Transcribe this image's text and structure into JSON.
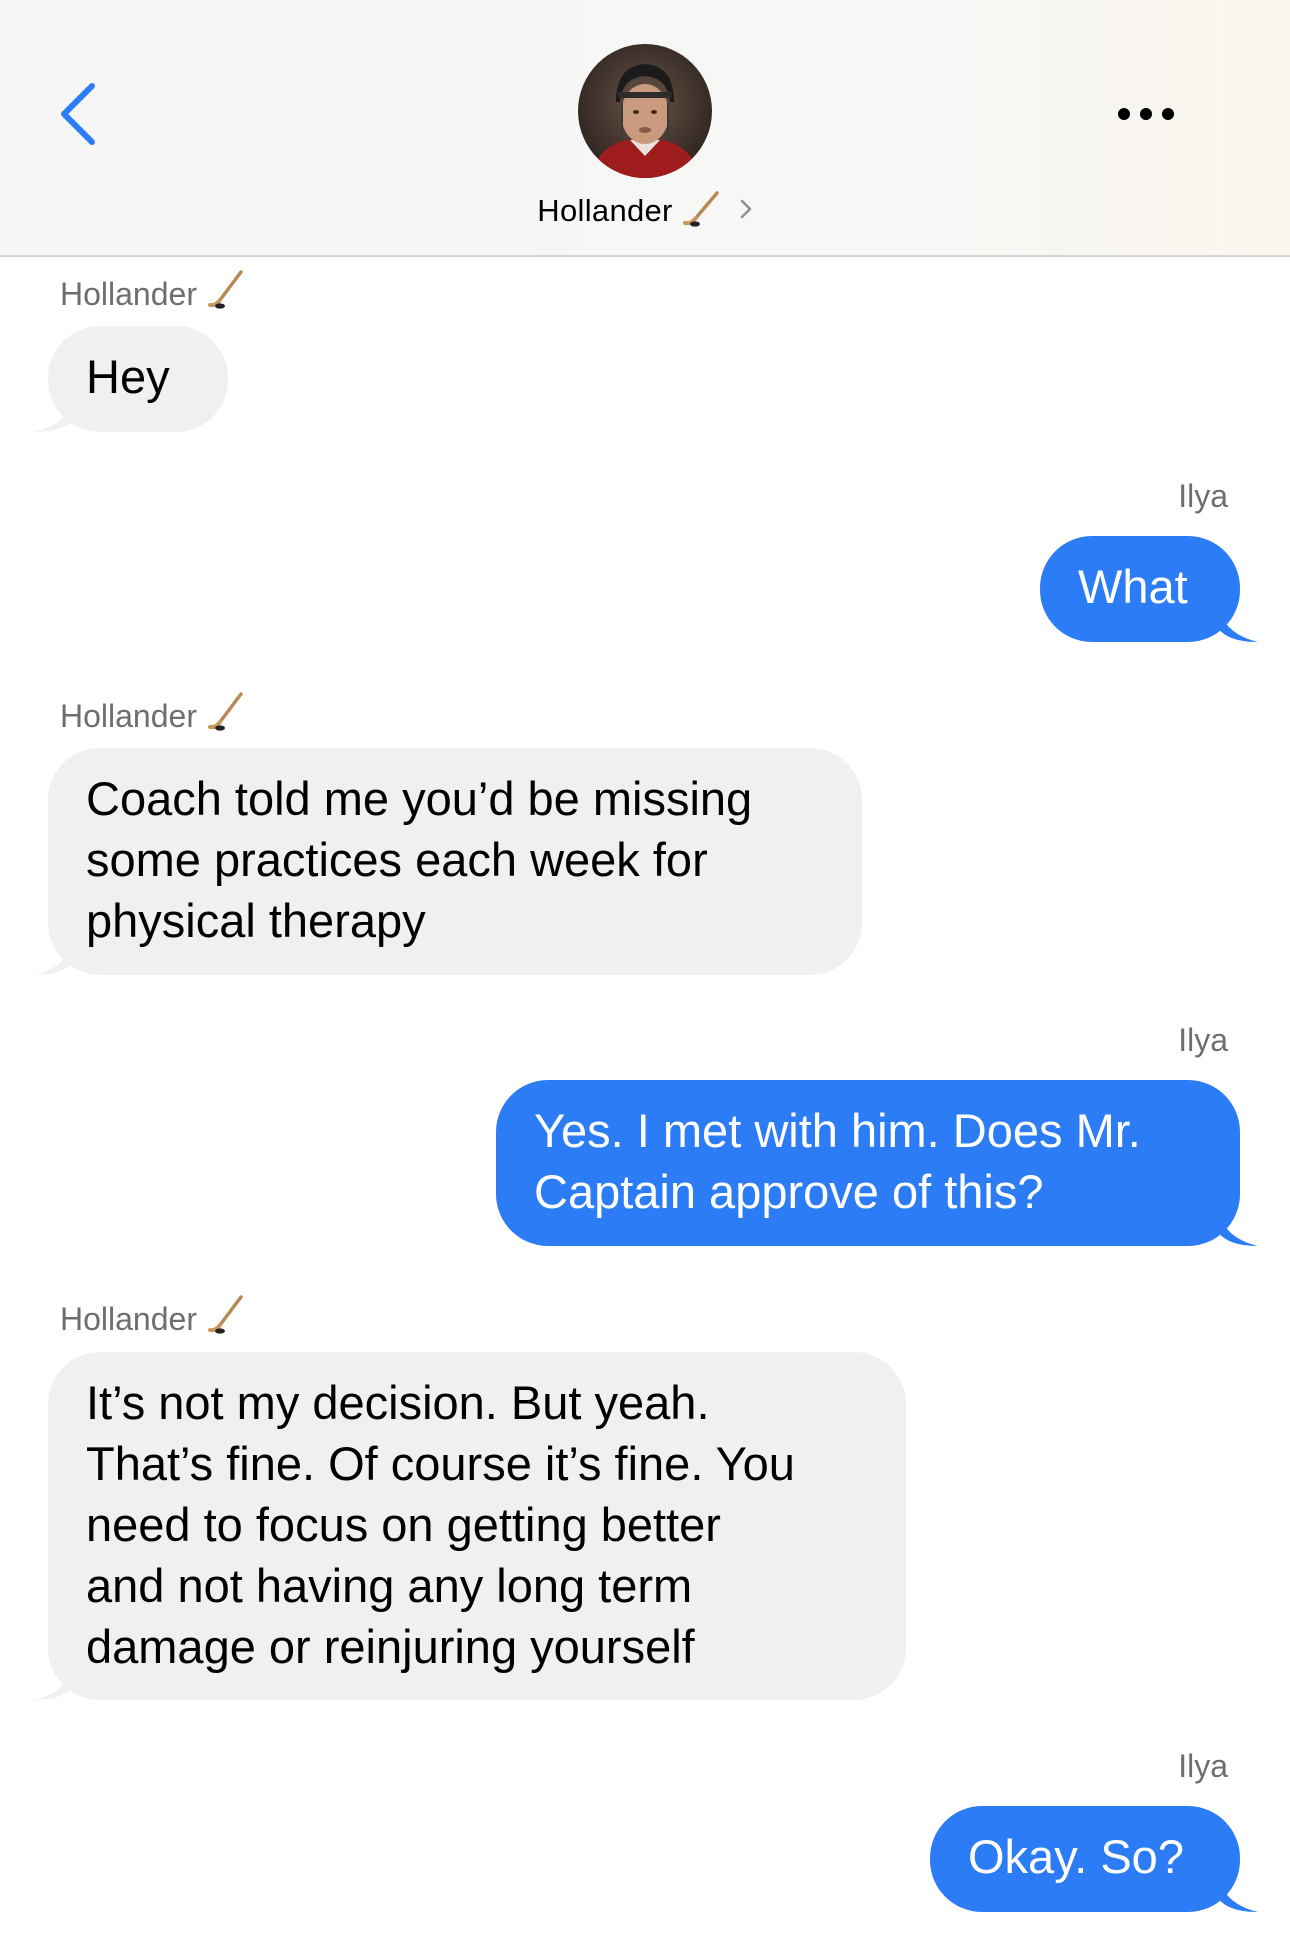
{
  "header": {
    "contact_name": "Hollander",
    "back_icon": "chevron-left-icon",
    "more_icon": "ellipsis-icon",
    "name_emoji": "hockey-stick-icon",
    "chevron": "chevron-right-icon"
  },
  "colors": {
    "accent": "#2c7cf6",
    "incoming_bubble": "#f0f0f2",
    "sender_label": "#6e6e72"
  },
  "messages": [
    {
      "sender": "Hollander",
      "text": "Hey",
      "direction": "incoming"
    },
    {
      "sender": "Ilya",
      "text": "What",
      "direction": "outgoing"
    },
    {
      "sender": "Hollander",
      "text": "Coach told me you’d be missing\nsome practices each week for\nphysical therapy",
      "direction": "incoming"
    },
    {
      "sender": "Ilya",
      "text": "Yes. I met with him. Does Mr.\nCaptain approve of this?",
      "direction": "outgoing"
    },
    {
      "sender": "Hollander",
      "text": "It’s not my decision. But yeah.\nThat’s fine. Of course it’s fine. You\nneed to focus on getting better\nand not having any long term\ndamage or reinjuring yourself",
      "direction": "incoming"
    },
    {
      "sender": "Ilya",
      "text": "Okay. So?",
      "direction": "outgoing"
    }
  ]
}
